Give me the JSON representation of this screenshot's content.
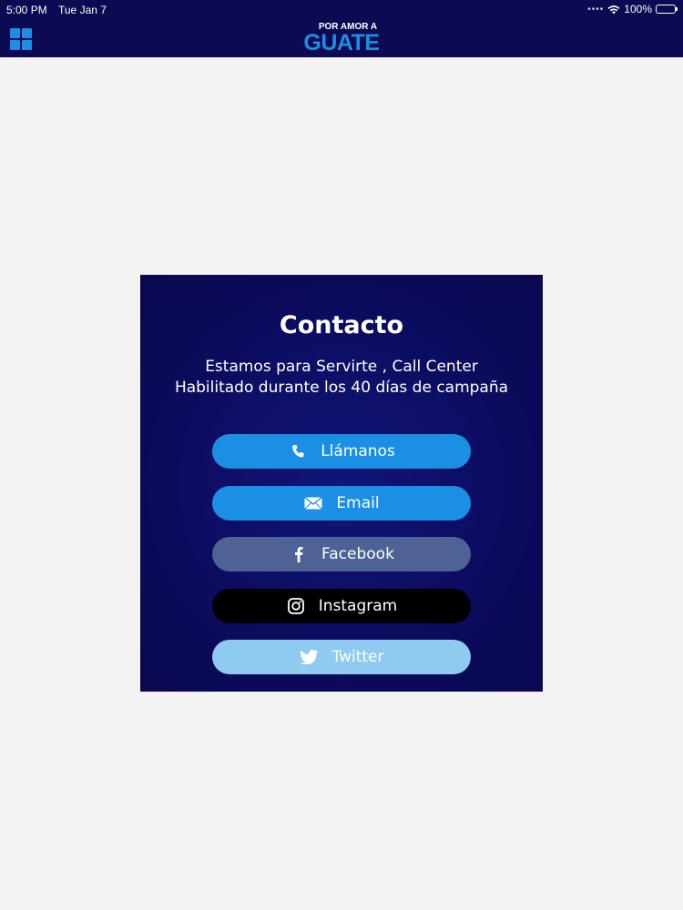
{
  "status_bar": {
    "time": "5:00 PM",
    "date": "Tue Jan 7",
    "battery": "100%"
  },
  "header": {
    "logo_small": "POR AMOR A",
    "logo_big": "GUATE"
  },
  "contact": {
    "title": "Contacto",
    "subtitle_line1": "Estamos para Servirte , Call Center",
    "subtitle_line2": "Habilitado durante los 40 días de campaña"
  },
  "buttons": {
    "call": {
      "label": "Llámanos",
      "icon": "phone-icon",
      "color": "#1a8fe3"
    },
    "email": {
      "label": "Email",
      "icon": "envelope-icon",
      "color": "#1a8fe3"
    },
    "facebook": {
      "label": "Facebook",
      "icon": "facebook-icon",
      "color": "#4f6296"
    },
    "instagram": {
      "label": "Instagram",
      "icon": "instagram-icon",
      "color": "#000000"
    },
    "twitter": {
      "label": "Twitter",
      "icon": "twitter-icon",
      "color": "#8fcaf0"
    }
  },
  "colors": {
    "nav_background": "#0b0a52",
    "accent": "#1a8fe3",
    "page_background": "#f3f3f3"
  }
}
